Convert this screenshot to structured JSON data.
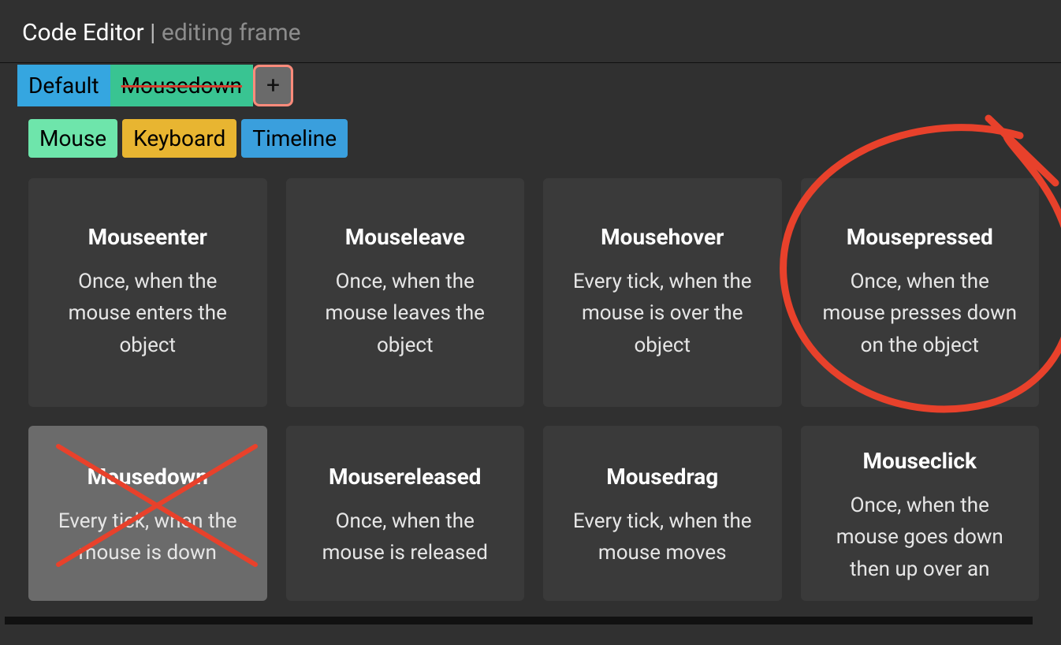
{
  "title": {
    "main": "Code Editor",
    "separator": " | ",
    "sub": "editing frame"
  },
  "tabs": {
    "default_label": "Default",
    "mousedown_label": "Mousedown",
    "add_label": "+"
  },
  "categories": {
    "mouse": "Mouse",
    "keyboard": "Keyboard",
    "timeline": "Timeline"
  },
  "events": [
    {
      "title": "Mouseenter",
      "desc": "Once, when the mouse enters the object"
    },
    {
      "title": "Mouseleave",
      "desc": "Once, when the mouse leaves the object"
    },
    {
      "title": "Mousehover",
      "desc": "Every tick, when the mouse is over the object"
    },
    {
      "title": "Mousepressed",
      "desc": "Once, when the mouse presses down on the object"
    },
    {
      "title": "Mousedown",
      "desc": "Every tick, when the mouse is down"
    },
    {
      "title": "Mousereleased",
      "desc": "Once, when the mouse is released"
    },
    {
      "title": "Mousedrag",
      "desc": "Every tick, when the mouse moves"
    },
    {
      "title": "Mouseclick",
      "desc": "Once, when the mouse goes down then up over an"
    }
  ],
  "annotations": {
    "circled_event": "Mousepressed",
    "crossed_event": "Mousedown",
    "crossed_tab": "Mousedown"
  }
}
